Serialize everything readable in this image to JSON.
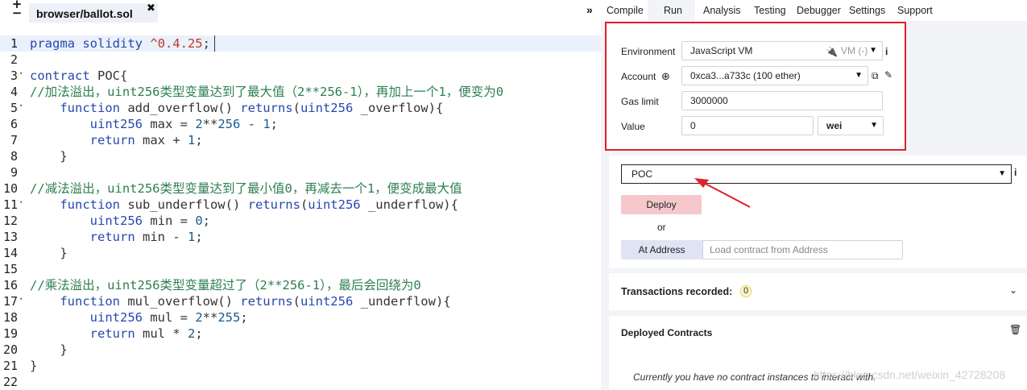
{
  "editor": {
    "plus_label": "+",
    "minus_label": "−",
    "file_tab": "browser/ballot.sol",
    "file_tab_close": "✖",
    "lines": [
      {
        "n": "1",
        "fold": "",
        "text": "",
        "active": true
      },
      {
        "n": "2",
        "fold": "",
        "text": ""
      },
      {
        "n": "3",
        "fold": "▾",
        "text": ""
      },
      {
        "n": "4",
        "fold": "",
        "text": ""
      },
      {
        "n": "5",
        "fold": "▾",
        "text": ""
      },
      {
        "n": "6",
        "fold": "",
        "text": ""
      },
      {
        "n": "7",
        "fold": "",
        "text": ""
      },
      {
        "n": "8",
        "fold": "",
        "text": ""
      },
      {
        "n": "9",
        "fold": "",
        "text": ""
      },
      {
        "n": "10",
        "fold": "",
        "text": ""
      },
      {
        "n": "11",
        "fold": "▾",
        "text": ""
      },
      {
        "n": "12",
        "fold": "",
        "text": ""
      },
      {
        "n": "13",
        "fold": "",
        "text": ""
      },
      {
        "n": "14",
        "fold": "",
        "text": ""
      },
      {
        "n": "15",
        "fold": "",
        "text": ""
      },
      {
        "n": "16",
        "fold": "",
        "text": ""
      },
      {
        "n": "17",
        "fold": "▾",
        "text": ""
      },
      {
        "n": "18",
        "fold": "",
        "text": ""
      },
      {
        "n": "19",
        "fold": "",
        "text": ""
      },
      {
        "n": "20",
        "fold": "",
        "text": ""
      },
      {
        "n": "21",
        "fold": "",
        "text": ""
      },
      {
        "n": "22",
        "fold": "",
        "text": ""
      }
    ],
    "code_tokens": [
      [
        [
          "kw",
          "pragma solidity "
        ],
        [
          "ver",
          "^0.4.25"
        ],
        [
          "plain",
          ";"
        ]
      ],
      [],
      [
        [
          "kw",
          "contract"
        ],
        [
          "plain",
          " POC{"
        ]
      ],
      [
        [
          "cmt",
          "//加法溢出，uint256类型变量达到了最大值（2**256-1），再加上一个1，便变为0"
        ]
      ],
      [
        [
          "plain",
          "    "
        ],
        [
          "kw",
          "function"
        ],
        [
          "plain",
          " add_overflow() "
        ],
        [
          "kw",
          "returns"
        ],
        [
          "plain",
          "("
        ],
        [
          "kw",
          "uint256"
        ],
        [
          "plain",
          " _overflow){"
        ]
      ],
      [
        [
          "plain",
          "        "
        ],
        [
          "kw",
          "uint256"
        ],
        [
          "plain",
          " max = "
        ],
        [
          "num",
          "2"
        ],
        [
          "plain",
          "**"
        ],
        [
          "num",
          "256"
        ],
        [
          "plain",
          " - "
        ],
        [
          "num",
          "1"
        ],
        [
          "plain",
          ";"
        ]
      ],
      [
        [
          "plain",
          "        "
        ],
        [
          "kw",
          "return"
        ],
        [
          "plain",
          " max + "
        ],
        [
          "num",
          "1"
        ],
        [
          "plain",
          ";"
        ]
      ],
      [
        [
          "plain",
          "    }"
        ]
      ],
      [],
      [
        [
          "cmt",
          "//减法溢出，uint256类型变量达到了最小值0，再减去一个1，便变成最大值"
        ]
      ],
      [
        [
          "plain",
          "    "
        ],
        [
          "kw",
          "function"
        ],
        [
          "plain",
          " sub_underflow() "
        ],
        [
          "kw",
          "returns"
        ],
        [
          "plain",
          "("
        ],
        [
          "kw",
          "uint256"
        ],
        [
          "plain",
          " _underflow){"
        ]
      ],
      [
        [
          "plain",
          "        "
        ],
        [
          "kw",
          "uint256"
        ],
        [
          "plain",
          " min = "
        ],
        [
          "num",
          "0"
        ],
        [
          "plain",
          ";"
        ]
      ],
      [
        [
          "plain",
          "        "
        ],
        [
          "kw",
          "return"
        ],
        [
          "plain",
          " min - "
        ],
        [
          "num",
          "1"
        ],
        [
          "plain",
          ";"
        ]
      ],
      [
        [
          "plain",
          "    }"
        ]
      ],
      [],
      [
        [
          "cmt",
          "//乘法溢出，uint256类型变量超过了（2**256-1），最后会回绕为0"
        ]
      ],
      [
        [
          "plain",
          "    "
        ],
        [
          "kw",
          "function"
        ],
        [
          "plain",
          " mul_overflow() "
        ],
        [
          "kw",
          "returns"
        ],
        [
          "plain",
          "("
        ],
        [
          "kw",
          "uint256"
        ],
        [
          "plain",
          " _underflow){"
        ]
      ],
      [
        [
          "plain",
          "        "
        ],
        [
          "kw",
          "uint256"
        ],
        [
          "plain",
          " mul = "
        ],
        [
          "num",
          "2"
        ],
        [
          "plain",
          "**"
        ],
        [
          "num",
          "255"
        ],
        [
          "plain",
          ";"
        ]
      ],
      [
        [
          "plain",
          "        "
        ],
        [
          "kw",
          "return"
        ],
        [
          "plain",
          " mul * "
        ],
        [
          "num",
          "2"
        ],
        [
          "plain",
          ";"
        ]
      ],
      [
        [
          "plain",
          "    }"
        ]
      ],
      [
        [
          "plain",
          "}"
        ]
      ],
      []
    ]
  },
  "panel": {
    "collapse_icon": "»",
    "tabs": [
      "Compile",
      "Run",
      "Analysis",
      "Testing",
      "Debugger",
      "Settings",
      "Support"
    ],
    "active_tab": "Run",
    "environment": {
      "label": "Environment",
      "value": "JavaScript VM",
      "hint": "VM (-)",
      "info": "i"
    },
    "account": {
      "label": "Account",
      "value": "0xca3...a733c (100 ether)"
    },
    "gas_limit": {
      "label": "Gas limit",
      "value": "3000000"
    },
    "value": {
      "label": "Value",
      "amount": "0",
      "unit": "wei"
    },
    "contract_select": "POC",
    "contract_info": "i",
    "deploy_label": "Deploy",
    "or_label": "or",
    "at_address_label": "At Address",
    "at_address_placeholder": "Load contract from Address",
    "transactions_label": "Transactions recorded:",
    "transactions_count": "0",
    "deployed_label": "Deployed Contracts",
    "no_instances": "Currently you have no contract instances to interact with.",
    "watermark": "https://blog.csdn.net/weixin_42728208"
  },
  "colors": {
    "highlight_box": "#e0202a",
    "arrow": "#e0202a",
    "deploy_button": "#f6c8cb",
    "keyword": "#2747b0",
    "comment": "#2e7f52"
  }
}
